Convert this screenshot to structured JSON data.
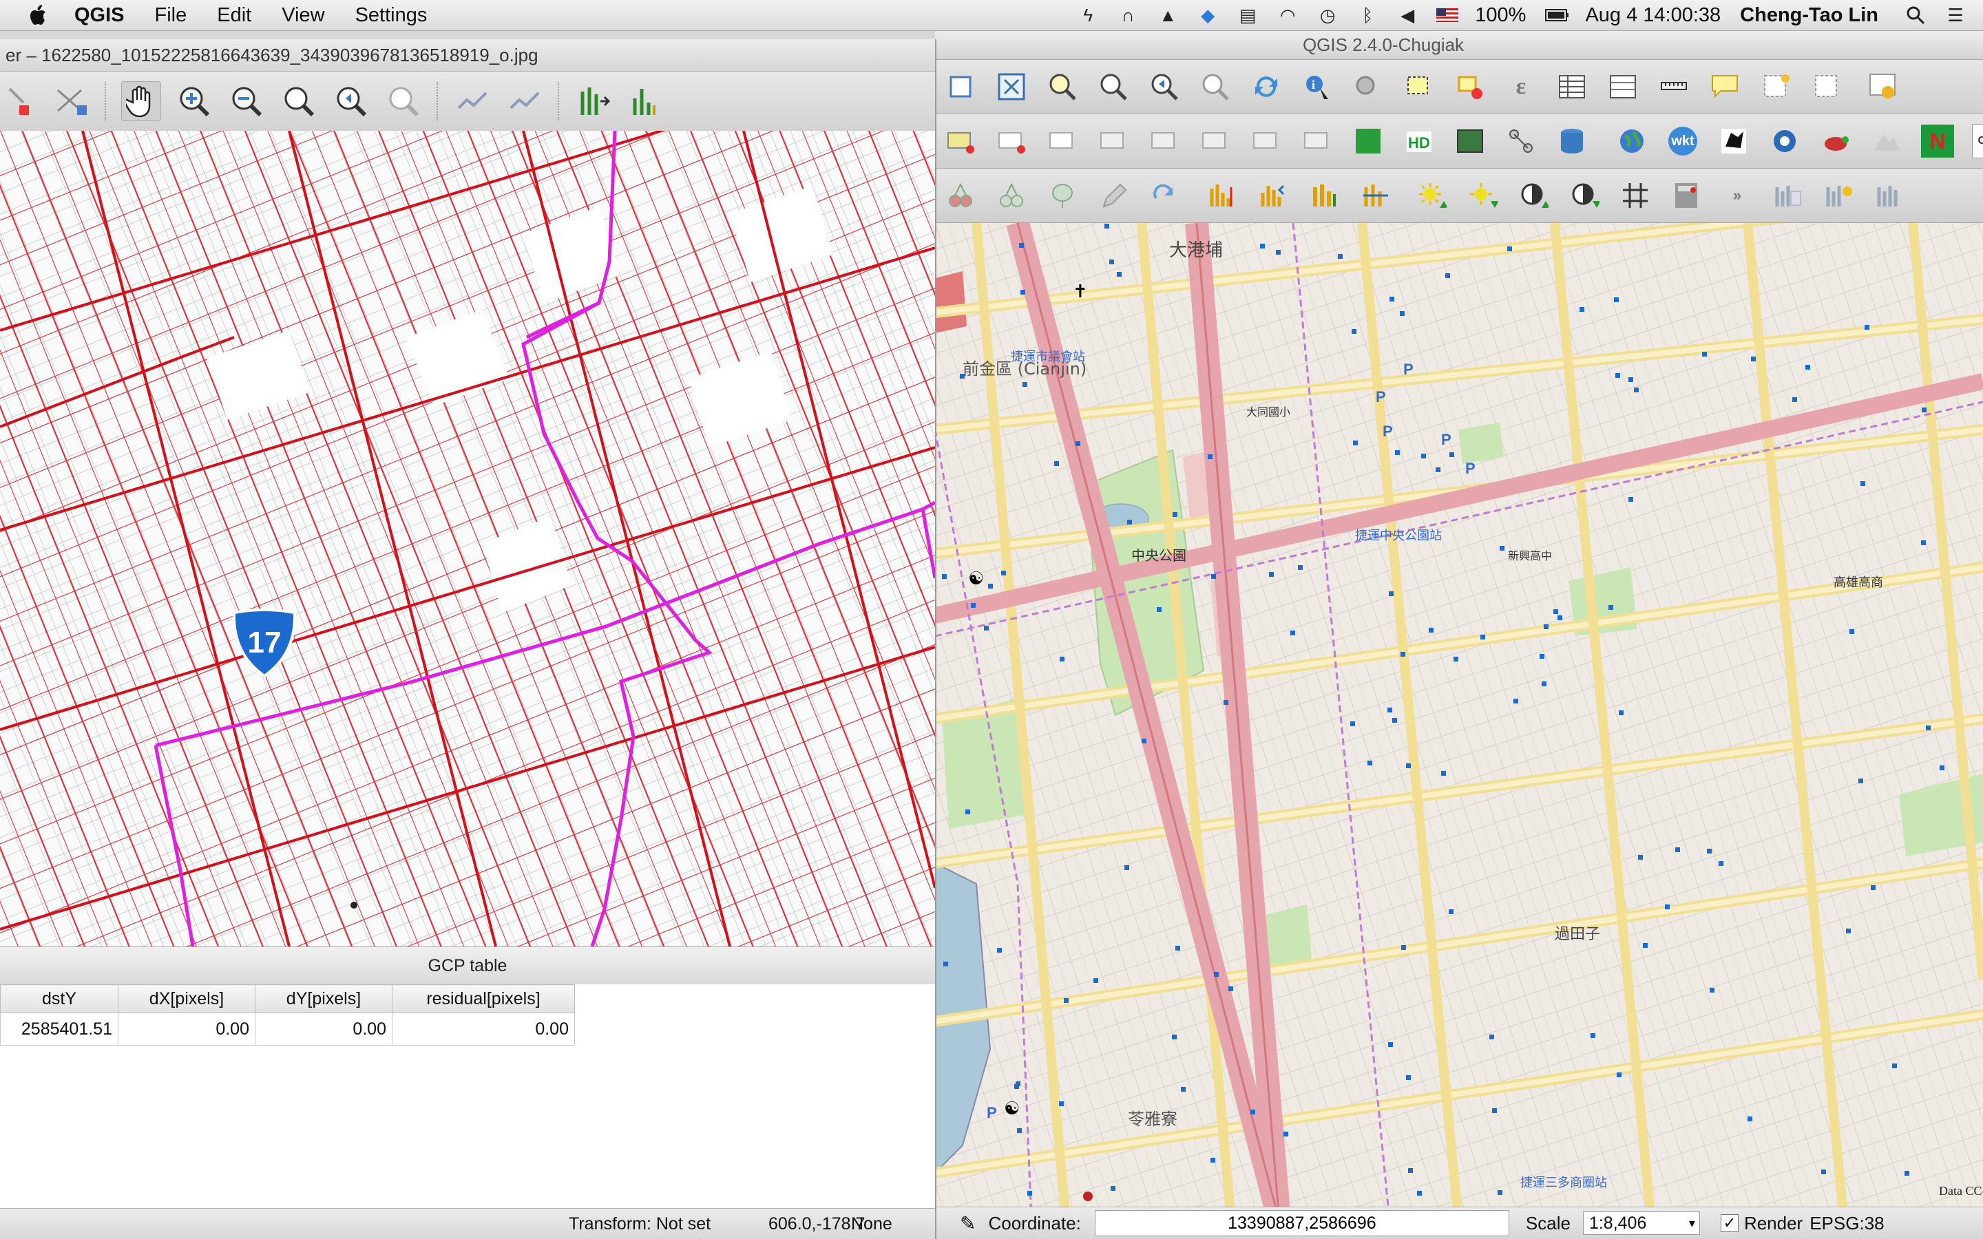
{
  "menubar": {
    "app": "QGIS",
    "items": [
      "File",
      "Edit",
      "View",
      "Settings"
    ],
    "battery": "100%",
    "datetime": "Aug 4  14:00:38",
    "user": "Cheng-Tao Lin"
  },
  "georeferencer": {
    "title": "er – 1622580_10152225816643639_3439039678136518919_o.jpg",
    "gcp_table_title": "GCP table",
    "gcp_columns": [
      "dstY",
      "dX[pixels]",
      "dY[pixels]",
      "residual[pixels]"
    ],
    "gcp_rows": [
      [
        "2585401.51",
        "0.00",
        "0.00",
        "0.00"
      ]
    ],
    "status": {
      "transform": "Transform: Not set",
      "coords": "606.0,-178.7",
      "crs": "None"
    },
    "route_marker": "17"
  },
  "qgis": {
    "title": "QGIS 2.4.0-Chugiak",
    "toolbar_labels": {
      "wkt": "wkt",
      "n": "N",
      "csv": "CSV"
    },
    "status": {
      "coordinate_label": "Coordinate:",
      "coordinate_value": "13390887,2586696",
      "scale_label": "Scale",
      "scale_value": "1:8,406",
      "render_label": "Render",
      "crs": "EPSG:38"
    },
    "map_labels": {
      "dagangpu": "大港埔",
      "qianjin": "前金區 (Cianjin)",
      "central_park": "中央公園",
      "mrt_central_park": "捷運中央公園站",
      "mrt_city_council": "捷運市議會站",
      "mrt_sanduo": "捷運三多商圈站",
      "guotianzi": "過田子",
      "lingyaliao": "苓雅寮",
      "kaohsiung_high": "高雄高商",
      "xinxing_high": "新興高中",
      "datong_elem": "大同國小",
      "copyright": "Data CC-By-S"
    }
  },
  "colors": {
    "road_red": "#d4101a",
    "highway_magenta": "#e020e0",
    "map_bg": "#eeeae2",
    "major_road": "#e8a0a8",
    "secondary_road": "#f5e6a8",
    "park_green": "#c9e6b4"
  }
}
